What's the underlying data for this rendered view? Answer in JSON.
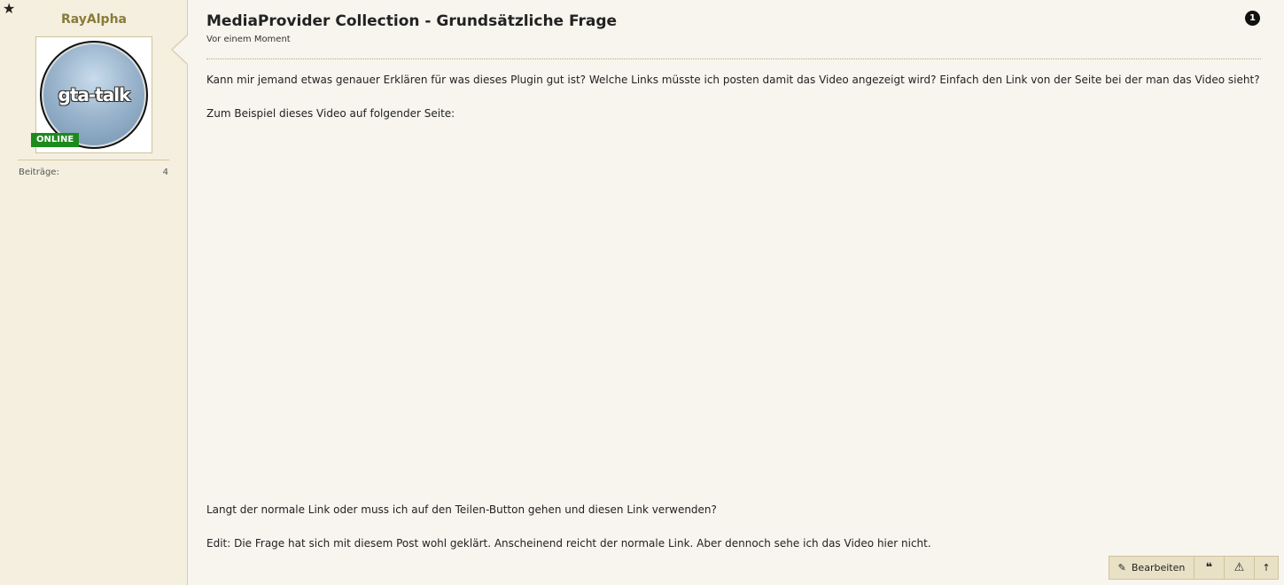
{
  "sidebar": {
    "star_icon": "★",
    "username": "RayAlpha",
    "avatar_text": "gta-talk",
    "online_badge": "ONLINE",
    "stats": [
      {
        "label": "Beiträge:",
        "value": "4"
      }
    ]
  },
  "post": {
    "title": "MediaProvider Collection - Grundsätzliche Frage",
    "time": "Vor einem Moment",
    "number": "1",
    "paragraphs": [
      "Kann mir jemand etwas genauer Erklären für was dieses Plugin gut ist? Welche Links müsste ich posten damit das Video angezeigt wird? Einfach den Link von der Seite bei der man das Video sieht?",
      "Zum Beispiel dieses Video auf folgender Seite:",
      "Langt der normale Link oder muss ich auf den Teilen-Button gehen und diesen Link verwenden?",
      "Edit: Die Frage hat sich mit diesem Post wohl geklärt. Anscheinend reicht der normale Link. Aber dennoch sehe ich das Video hier nicht."
    ]
  },
  "actions": {
    "edit_label": "Bearbeiten",
    "edit_icon": "✎",
    "quote_icon": "❝",
    "report_icon": "⚠",
    "top_icon": "↑"
  }
}
